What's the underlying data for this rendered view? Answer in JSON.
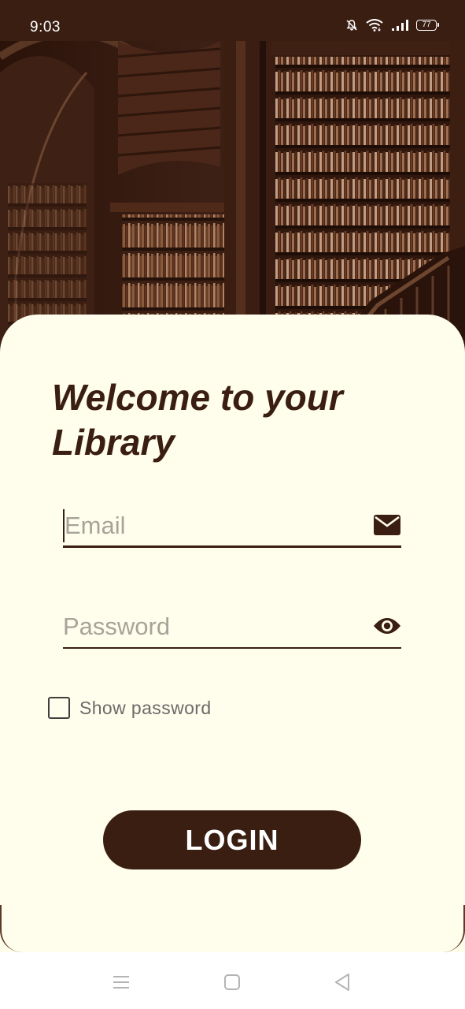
{
  "status_bar": {
    "time": "9:03",
    "battery": "77",
    "icons": [
      "mute-bell-icon",
      "wifi-icon",
      "signal-icon",
      "battery-icon"
    ]
  },
  "hero": {
    "image": "library-bookshelves-photo"
  },
  "login": {
    "title": "Welcome to your Library",
    "email_placeholder": "Email",
    "email_value": "",
    "password_placeholder": "Password",
    "password_value": "",
    "show_password_label": "Show password",
    "show_password_checked": false,
    "login_button": "LOGIN"
  },
  "nav_bar": {
    "items": [
      "menu-icon",
      "home-icon",
      "back-icon"
    ]
  },
  "colors": {
    "primary": "#3a1e12",
    "card_background": "#fffdeb",
    "placeholder": "#a7a39a",
    "label": "#6b6b6b"
  }
}
